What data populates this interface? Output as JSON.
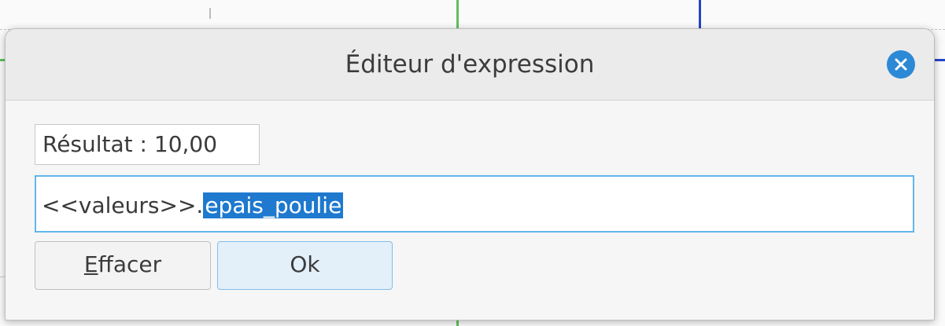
{
  "dialog": {
    "title": "Éditeur d'expression",
    "close_icon": "close-icon",
    "result_text": "Résultat : 10,00",
    "expression_prefix": "<<valeurs>>.",
    "expression_selected": "epais_poulie",
    "clear_button": {
      "mnemonic": "E",
      "rest": "ffacer"
    },
    "ok_button": "Ok"
  },
  "colors": {
    "accent": "#2c89d6",
    "selection": "#1e79cf",
    "focus_border": "#62b6ec",
    "ok_button_bg": "#e3eff9"
  }
}
